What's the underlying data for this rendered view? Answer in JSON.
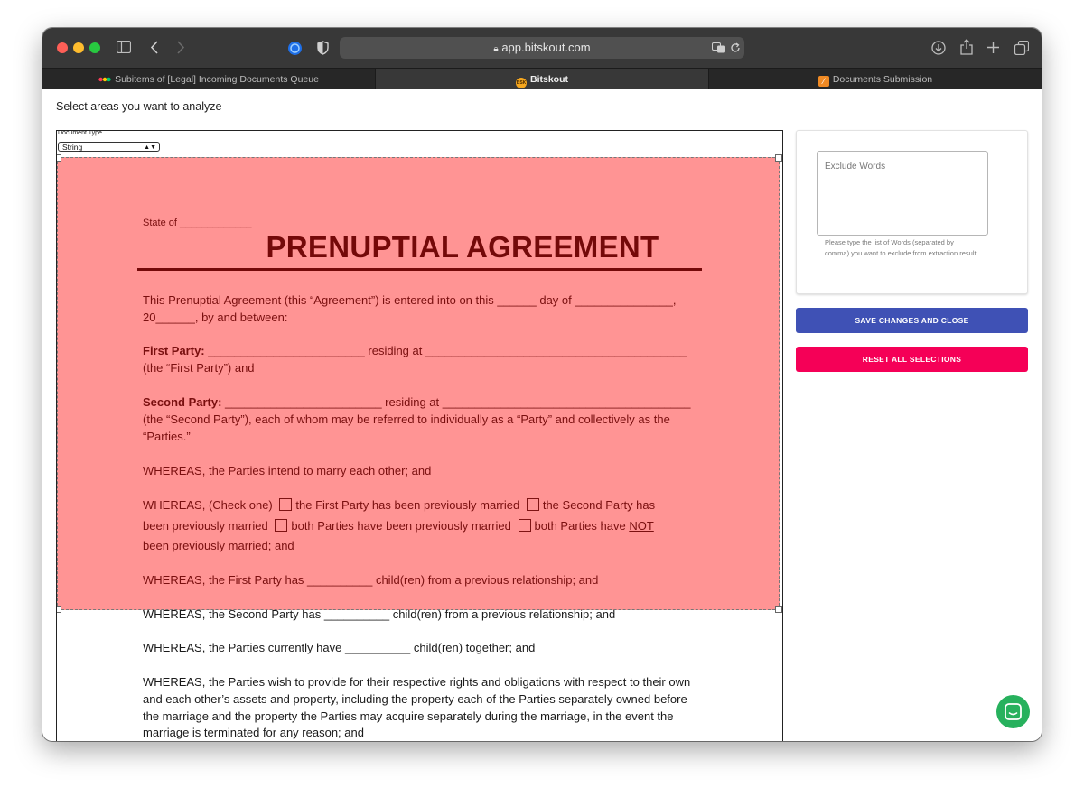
{
  "browser": {
    "url": "app.bitskout.com",
    "tabs": [
      {
        "label": "Subitems of [Legal] Incoming Documents Queue",
        "icon": "monday-icon",
        "active": false
      },
      {
        "label": "Bitskout",
        "icon": "bitskout-logo-icon",
        "active": true
      },
      {
        "label": "Documents Submission",
        "icon": "form-icon",
        "active": false
      }
    ]
  },
  "page": {
    "heading": "Select areas you want to analyze"
  },
  "doctype": {
    "label": "Document Type",
    "value": "String"
  },
  "document": {
    "state_line": "State of _____________",
    "title": "PRENUPTIAL AGREEMENT",
    "intro1": "This Prenuptial Agreement (this “Agreement”) is entered into on this ______ day of _______________,",
    "intro2": "20______, by and between:",
    "first_party_label": "First Party:",
    "first_party_rest": " ________________________ residing at ________________________________________",
    "first_party_line2": "(the “First Party”) and",
    "second_party_label": "Second Party:",
    "second_party_rest": " ________________________ residing at ______________________________________",
    "second_party_line2": "(the “Second Party”), each of whom may be referred to individually as a “Party” and collectively as the",
    "second_party_line3": "“Parties.”",
    "whereas_marry": "WHEREAS, the Parties intend to marry each other; and",
    "check_prefix": "WHEREAS, (Check one)",
    "check_opt1": "the First Party has been previously married",
    "check_opt2a": "the Second Party has",
    "check_opt2b": "been previously married",
    "check_opt3": "both Parties have been previously married",
    "check_opt4a": "both Parties have",
    "check_opt4_not": "NOT",
    "check_line3": "been previously married; and",
    "whereas_first_children": "WHEREAS, the First Party has __________ child(ren) from a previous relationship; and",
    "whereas_second_children": "WHEREAS, the Second Party has __________ child(ren) from a previous relationship; and",
    "whereas_together": "WHEREAS, the Parties currently have __________ child(ren) together; and",
    "whereas_rights1": "WHEREAS, the Parties wish to provide for their respective rights and obligations with respect to their own",
    "whereas_rights2": "and each other’s assets and property, including the property each of the Parties separately owned before",
    "whereas_rights3": "the marriage and the property the Parties may acquire separately during the marriage, in the event the",
    "whereas_rights4": "marriage is terminated for any reason; and"
  },
  "sidebar": {
    "exclude_placeholder": "Exclude Words",
    "exclude_help": "Please type the list of Words (separated by comma) you want to exclude from extraction result",
    "save_label": "SAVE CHANGES AND CLOSE",
    "reset_label": "RESET ALL SELECTIONS"
  },
  "colors": {
    "selection_overlay": "#ff0000",
    "save_button": "#3f51b5",
    "reset_button": "#f50057",
    "chat_button": "#27b15d"
  }
}
